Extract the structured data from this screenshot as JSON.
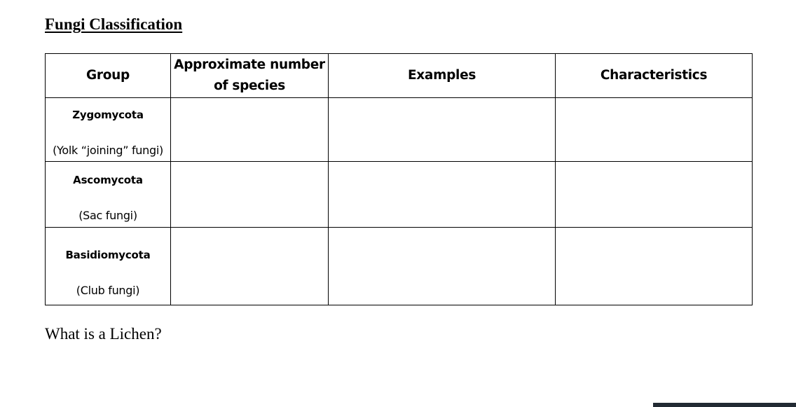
{
  "document": {
    "title": "Fungi Classification",
    "question": "What is a Lichen?"
  },
  "table": {
    "headers": [
      "Group",
      "Approximate number of species",
      "Examples",
      "Characteristics"
    ],
    "rows": [
      {
        "group": "Zygomycota",
        "common_name": "(Yolk “joining” fungi)",
        "species_count": "",
        "examples": "",
        "characteristics": ""
      },
      {
        "group": "Ascomycota",
        "common_name": "(Sac fungi)",
        "species_count": "",
        "examples": "",
        "characteristics": ""
      },
      {
        "group": "Basidiomycota",
        "common_name": "(Club fungi)",
        "species_count": "",
        "examples": "",
        "characteristics": ""
      }
    ]
  },
  "colors": {
    "text": "#000000",
    "border": "#000000",
    "background": "#ffffff",
    "bottom_bar": "#222a33"
  }
}
